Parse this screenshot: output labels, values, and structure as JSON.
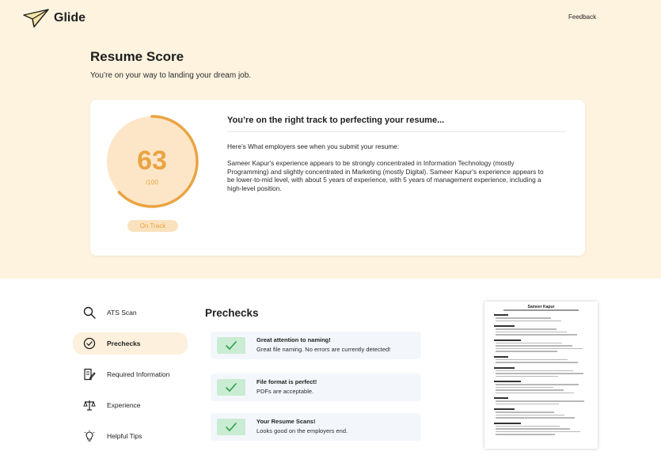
{
  "brand": {
    "name": "Glide",
    "feedback_label": "Feedback"
  },
  "header": {
    "title": "Resume Score",
    "subtitle": "You’re on your way to landing your dream job."
  },
  "score": {
    "value": "63",
    "out_of": "/100",
    "fraction": 0.63,
    "status": "On Track",
    "accent": "#e9a443"
  },
  "summary": {
    "heading": "You’re on the right track to perfecting your resume...",
    "lead": "Here’s What employers see when you submit your resume:",
    "body": "Sameer Kapur's experience appears to be strongly concentrated in Information Technology (mostly Programming) and slightly concentrated in Marketing (mostly Digital). Sameer Kapur's experience appears to be lower-to-mid level, with about 5 years of experience, with 5 years of management experience, including a high-level position."
  },
  "nav": {
    "items": [
      {
        "label": "ATS Scan",
        "icon": "search-icon"
      },
      {
        "label": "Prechecks",
        "icon": "check-circle-icon",
        "active": true
      },
      {
        "label": "Required Information",
        "icon": "document-edit-icon"
      },
      {
        "label": "Experience",
        "icon": "scale-icon"
      },
      {
        "label": "Helpful Tips",
        "icon": "lightbulb-icon"
      }
    ]
  },
  "prechecks": {
    "title": "Prechecks",
    "items": [
      {
        "title": "Great attention to naming!",
        "desc": "Great file naming. No errors are currently detected!"
      },
      {
        "title": "File format is perfect!",
        "desc": "PDFs are acceptable."
      },
      {
        "title": "Your Resume Scans!",
        "desc": "Looks good on the employers end."
      }
    ]
  },
  "resume_preview": {
    "name": "Sameer Kapur"
  }
}
